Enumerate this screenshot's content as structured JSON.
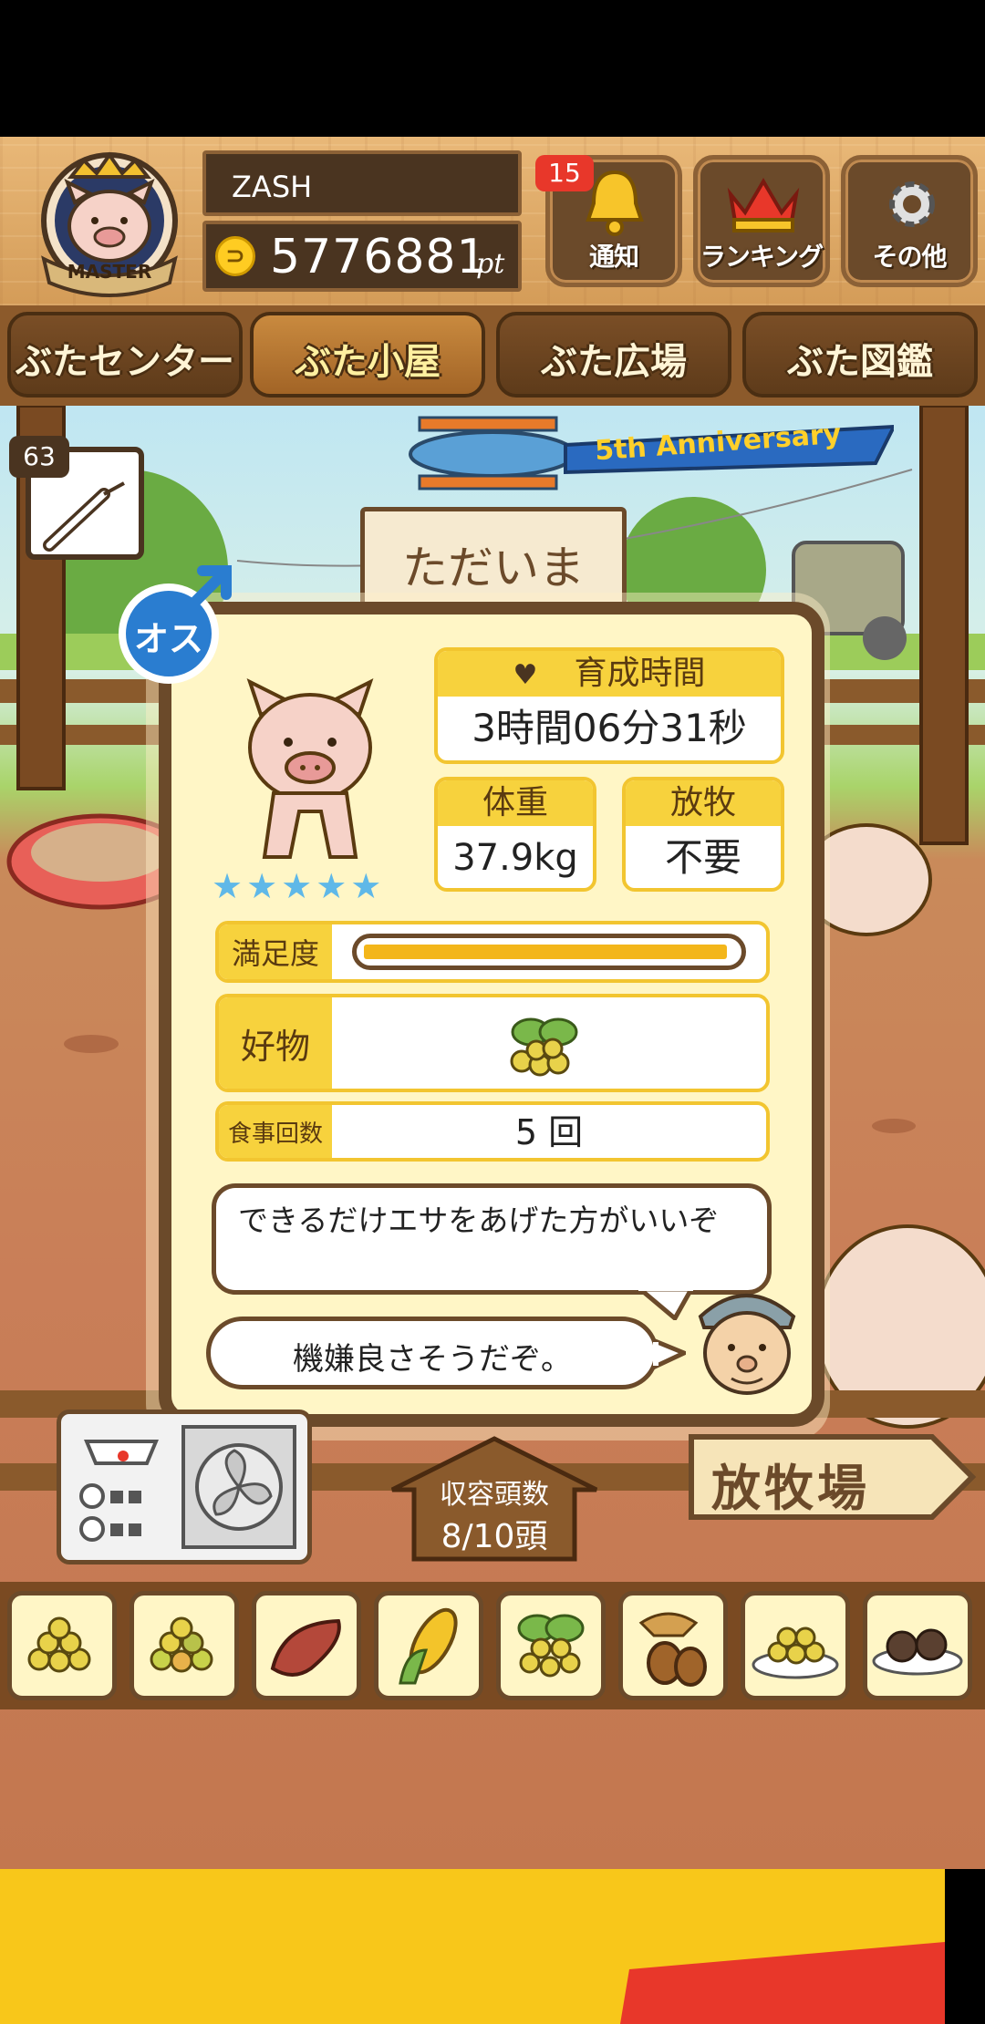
{
  "header": {
    "player_name": "ZASH",
    "points": "5776881",
    "points_unit": "pt",
    "master_badge_text": "MASTER",
    "notification_count": "15",
    "buttons": {
      "notifications": "通知",
      "ranking": "ランキング",
      "other": "その他"
    }
  },
  "nav": {
    "tabs": [
      "ぶたセンター",
      "ぶた小屋",
      "ぶた広場",
      "ぶた図鑑"
    ],
    "active_index": 1
  },
  "scene": {
    "syringe_count": "63",
    "banner_text": "5th Anniversary",
    "sign_text": "ただいま",
    "capacity_label": "収容頭数",
    "capacity_value": "8/10頭",
    "pasture_sign": "放牧場"
  },
  "pig": {
    "gender_label": "オス",
    "stars": "★★★★★",
    "raise_time_label": "育成時間",
    "raise_time_value": "3時間06分31秒",
    "weight_label": "体重",
    "weight_value": "37.9kg",
    "pasture_label": "放牧",
    "pasture_value": "不要",
    "satisfaction_label": "満足度",
    "satisfaction_level": 0.98,
    "favorite_label": "好物",
    "meals_label": "食事回数",
    "meals_value": "5 回",
    "advice_text": "できるだけエサをあげた方がいいぞ",
    "mood_text": "機嫌良さそうだぞ。"
  },
  "feeds": [
    "grain",
    "mixed-grain",
    "sweet-potato",
    "corn",
    "soybean-leaves",
    "acorn",
    "grain-plate",
    "truffle-plate"
  ],
  "colors": {
    "wood": "#deaa68",
    "dark_wood": "#6b4a2a",
    "panel_bg": "#fff6c6",
    "accent_yellow": "#f7d23d",
    "gender_blue": "#2a7dd0"
  }
}
